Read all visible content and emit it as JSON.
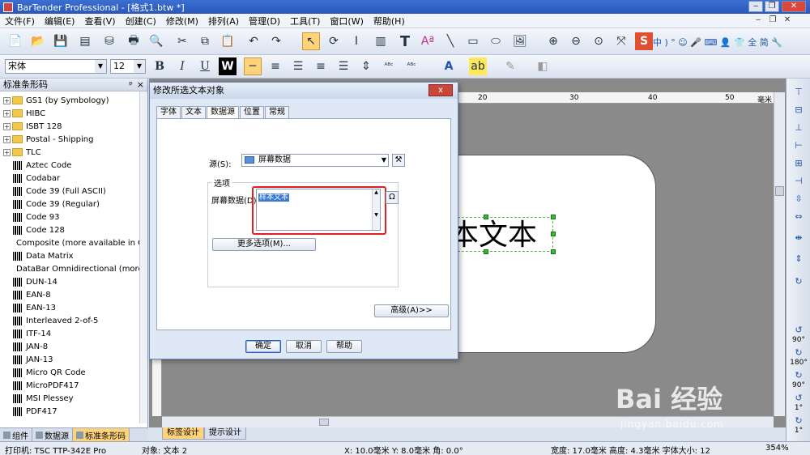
{
  "window": {
    "title": "BarTender Professional - [格式1.btw *]"
  },
  "menubar": {
    "items": [
      "文件(F)",
      "编辑(E)",
      "查看(V)",
      "创建(C)",
      "修改(M)",
      "排列(A)",
      "管理(D)",
      "工具(T)",
      "窗口(W)",
      "帮助(H)"
    ]
  },
  "format_toolbar": {
    "font": "宋体",
    "size": "12",
    "bold": "B",
    "italic": "I",
    "underline": "U",
    "wbutton": "W"
  },
  "ime_bar": {
    "label": "中 ) ° ☺ 🎤 ⌨ 👤 👕 全 简 🔧"
  },
  "left_panel": {
    "title": "标准条形码",
    "pin": "ᵖ",
    "close": "×",
    "folders": [
      "GS1 (by Symbology)",
      "HIBC",
      "ISBT 128",
      "Postal - Shipping",
      "TLC"
    ],
    "barcodes": [
      "Aztec Code",
      "Codabar",
      "Code 39 (Full ASCII)",
      "Code 39 (Regular)",
      "Code 93",
      "Code 128",
      "Composite (more available in GS",
      "Data Matrix",
      "DataBar Omnidirectional (more a",
      "DUN-14",
      "EAN-8",
      "EAN-13",
      "Interleaved 2-of-5",
      "ITF-14",
      "JAN-8",
      "JAN-13",
      "Micro QR Code",
      "MicroPDF417",
      "MSI Plessey",
      "PDF417"
    ],
    "tabs": [
      "组件",
      "数据源",
      "标准条形码"
    ]
  },
  "canvas": {
    "ruler_ticks": [
      "20",
      "30",
      "40",
      "50",
      "毫米"
    ],
    "label_text": "本文本",
    "tabs": [
      "标签设计",
      "提示设计"
    ]
  },
  "right_toolbar": {
    "rotate_labels": [
      "90°",
      "180°",
      "90°",
      "1°",
      "1°"
    ]
  },
  "dialog": {
    "title": "修改所选文本对象",
    "close": "x",
    "tabs": [
      "字体",
      "文本",
      "数据源",
      "位置",
      "常规"
    ],
    "selected_tab": "数据源",
    "source_label": "源(S):",
    "source_value": "屏幕数据",
    "options_title": "选项",
    "screen_data_label": "屏幕数据(D):",
    "screen_data_value": "样本文本",
    "omega": "Ω",
    "more_options": "更多选项(M)...",
    "advanced": "高级(A)>>",
    "ok": "确定",
    "cancel": "取消",
    "help": "帮助"
  },
  "statusbar": {
    "printer": "打印机: TSC TTP-342E Pro",
    "object": "对象: 文本 2",
    "position": "X: 10.0毫米  Y: 8.0毫米  角: 0.0°",
    "size": "宽度: 17.0毫米  高度: 4.3毫米  字体大小: 12",
    "zoom": "354%"
  },
  "watermark": {
    "main": "Bai 经验",
    "sub": "jingyan.baidu.com"
  }
}
